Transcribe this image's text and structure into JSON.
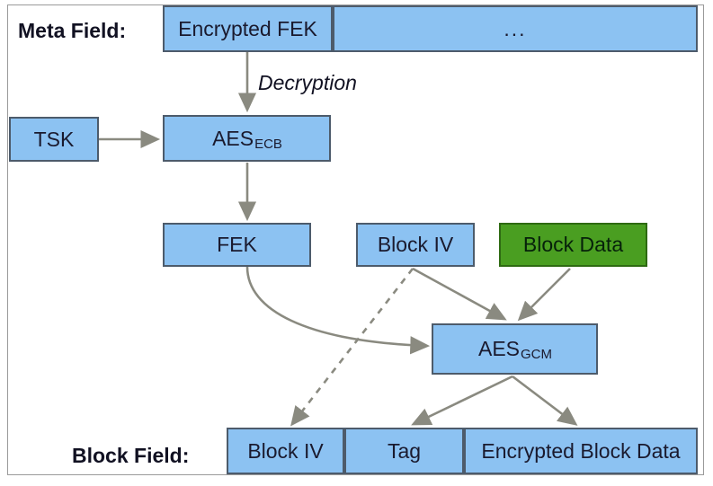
{
  "diagram": {
    "title_row_label": "Meta Field:",
    "bottom_row_label": "Block Field:",
    "annotation_decryption": "Decryption",
    "colors": {
      "box_fill_blue": "#8cc2f2",
      "box_fill_green": "#4a9e21",
      "box_border": "#4d5b6b",
      "box_border_green": "#2e6a12",
      "arrow": "#7a7a72",
      "frame": "#9a9a9a",
      "text": "#1a1a2e"
    },
    "meta_field": {
      "label": "Meta Field:",
      "cells": [
        {
          "text": "Encrypted FEK"
        },
        {
          "text": "..."
        }
      ]
    },
    "block_field": {
      "label": "Block Field:",
      "cells": [
        {
          "text": "Block IV"
        },
        {
          "text": "Tag"
        },
        {
          "text": "Encrypted Block Data"
        }
      ]
    },
    "nodes": {
      "tsk": "TSK",
      "aes_ecb_main": "AES",
      "aes_ecb_sub": "ECB",
      "fek": "FEK",
      "block_iv": "Block IV",
      "block_data": "Block Data",
      "aes_gcm_main": "AES",
      "aes_gcm_sub": "GCM"
    },
    "edges": [
      {
        "name": "encrypted-fek-to-aes-ecb",
        "style": "solid",
        "label": "Decryption"
      },
      {
        "name": "tsk-to-aes-ecb",
        "style": "solid",
        "label": ""
      },
      {
        "name": "aes-ecb-to-fek",
        "style": "solid",
        "label": ""
      },
      {
        "name": "fek-to-aes-gcm",
        "style": "curved-solid",
        "label": ""
      },
      {
        "name": "block-iv-to-aes-gcm",
        "style": "solid",
        "label": ""
      },
      {
        "name": "block-data-to-aes-gcm",
        "style": "solid",
        "label": ""
      },
      {
        "name": "block-iv-to-block-field-iv",
        "style": "dashed",
        "label": ""
      },
      {
        "name": "aes-gcm-to-tag",
        "style": "solid",
        "label": ""
      },
      {
        "name": "aes-gcm-to-encrypted-block-data",
        "style": "solid",
        "label": ""
      }
    ]
  }
}
